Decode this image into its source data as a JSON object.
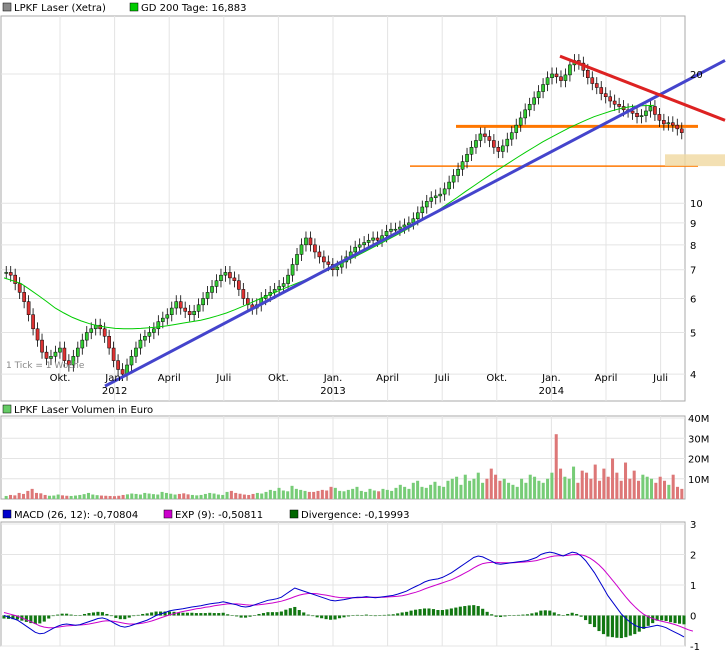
{
  "chart_data": [
    {
      "type": "candlestick",
      "legend": [
        {
          "name": "LPKF Laser (Xetra)",
          "color": "#888888"
        },
        {
          "name": "GD 200 Tage: 16,883",
          "color": "#00cc00"
        }
      ],
      "yscale": "log",
      "ylim": [
        3.5,
        27
      ],
      "y_ticks": [
        4,
        5,
        6,
        7,
        8,
        9,
        10,
        20
      ],
      "x_ticks": [
        "Okt.",
        "Jan.",
        "April",
        "Juli",
        "Okt.",
        "Jan.",
        "April",
        "Juli",
        "Okt.",
        "Jan.",
        "April",
        "Juli"
      ],
      "year_labels": [
        "2012",
        "2013",
        "2014"
      ],
      "note": "1 Tick = 1 Woche",
      "close_series": [
        6.9,
        6.8,
        6.5,
        6.2,
        5.9,
        5.5,
        5.1,
        4.8,
        4.5,
        4.35,
        4.4,
        4.5,
        4.6,
        4.3,
        4.2,
        4.4,
        4.6,
        4.8,
        5.0,
        5.1,
        5.2,
        5.1,
        4.9,
        4.6,
        4.3,
        4.1,
        4.0,
        4.2,
        4.4,
        4.6,
        4.8,
        4.9,
        5.0,
        5.1,
        5.3,
        5.4,
        5.5,
        5.7,
        5.9,
        5.7,
        5.6,
        5.5,
        5.6,
        5.8,
        6.0,
        6.2,
        6.4,
        6.6,
        6.8,
        6.9,
        6.7,
        6.6,
        6.3,
        6.0,
        5.8,
        5.7,
        5.8,
        6.0,
        6.1,
        6.2,
        6.3,
        6.4,
        6.5,
        6.8,
        7.2,
        7.6,
        8.0,
        8.3,
        8.0,
        7.7,
        7.5,
        7.3,
        7.2,
        7.0,
        7.1,
        7.3,
        7.5,
        7.7,
        7.9,
        8.0,
        8.1,
        8.2,
        8.3,
        8.2,
        8.4,
        8.6,
        8.7,
        8.7,
        8.8,
        8.9,
        9.0,
        9.2,
        9.5,
        9.8,
        10.1,
        10.3,
        10.4,
        10.5,
        10.8,
        11.2,
        11.6,
        12.0,
        12.5,
        13.0,
        13.5,
        14.0,
        14.5,
        14.3,
        14.0,
        13.5,
        13.2,
        13.6,
        14.1,
        14.6,
        15.2,
        15.8,
        16.5,
        17.0,
        17.6,
        18.2,
        18.9,
        19.6,
        20.0,
        19.7,
        19.3,
        19.9,
        21.0,
        21.5,
        21.2,
        20.4,
        19.6,
        19.0,
        18.6,
        18.0,
        17.7,
        17.3,
        17.0,
        16.8,
        16.5,
        16.4,
        16.2,
        15.9,
        16.0,
        16.4,
        16.8,
        16.1,
        15.6,
        15.3,
        15.4,
        15.2,
        14.9,
        14.6
      ],
      "ma200_series": [
        6.7,
        6.6,
        6.5,
        6.3,
        6.1,
        5.9,
        5.7,
        5.55,
        5.42,
        5.32,
        5.24,
        5.18,
        5.14,
        5.11,
        5.1,
        5.1,
        5.11,
        5.13,
        5.15,
        5.18,
        5.22,
        5.26,
        5.3,
        5.34,
        5.4,
        5.47,
        5.55,
        5.65,
        5.76,
        5.88,
        6.0,
        6.12,
        6.24,
        6.36,
        6.48,
        6.6,
        6.72,
        6.85,
        7.0,
        7.16,
        7.33,
        7.5,
        7.68,
        7.86,
        8.05,
        8.25,
        8.45,
        8.67,
        8.9,
        9.15,
        9.42,
        9.7,
        10.0,
        10.32,
        10.66,
        11.0,
        11.35,
        11.7,
        12.05,
        12.4,
        12.78,
        13.15,
        13.52,
        13.9,
        14.25,
        14.6,
        14.95,
        15.28,
        15.6,
        15.9,
        16.15,
        16.4,
        16.6,
        16.75,
        16.85,
        16.88,
        16.9
      ],
      "reference_lines": [
        {
          "name": "rising-trend",
          "color": "#4444cc",
          "from": [
            "2011-12",
            3.75
          ],
          "to": [
            "2014-08",
            21.5
          ]
        },
        {
          "name": "falling-trend",
          "color": "#dd2222",
          "from": [
            "2014-01",
            22.0
          ],
          "to": [
            "2014-08",
            15.6
          ]
        },
        {
          "name": "resistance-line",
          "color": "#ff7700",
          "value": 15.1
        },
        {
          "name": "support-line",
          "color": "#ff7700",
          "value": 12.2
        }
      ]
    },
    {
      "type": "bar",
      "legend": [
        {
          "name": "LPKF Laser Volumen in Euro",
          "color": "#66cc66"
        }
      ],
      "y_ticks": [
        "10M",
        "20M",
        "30M",
        "40M"
      ],
      "ylim": [
        0,
        40
      ],
      "values_millions": [
        1.5,
        2,
        1.8,
        3,
        2.5,
        4,
        5,
        3,
        2.8,
        2,
        1.6,
        1.7,
        2.2,
        1.8,
        1.6,
        1.5,
        1.7,
        2,
        2.4,
        3,
        2.2,
        1.9,
        1.7,
        1.6,
        1.5,
        1.4,
        1.6,
        2,
        2.3,
        2.7,
        2.5,
        2.2,
        3,
        2.7,
        2.4,
        2.2,
        3.5,
        3,
        2.6,
        2.2,
        2.5,
        2.8,
        2.3,
        2,
        1.8,
        2,
        2.5,
        3,
        2.7,
        2.2,
        2,
        3.5,
        4,
        3,
        2.6,
        2.2,
        2,
        2.5,
        3,
        2.7,
        3.5,
        4.5,
        4,
        5.5,
        4.2,
        3.8,
        6.5,
        5,
        4.5,
        4,
        3.5,
        3.5,
        4,
        4.5,
        4.2,
        6,
        5.5,
        4,
        3.8,
        4.5,
        5,
        6,
        4,
        3.5,
        5,
        4.2,
        3.8,
        5,
        4.5,
        4,
        5.5,
        7,
        6,
        5,
        8,
        9,
        6,
        5.5,
        7,
        8.5,
        6.5,
        6,
        9,
        10,
        11,
        7,
        12,
        9,
        10,
        13,
        8,
        10,
        15,
        12,
        9,
        10,
        8,
        7,
        6,
        10,
        8,
        12,
        11,
        9,
        8,
        10,
        13,
        32,
        15,
        11,
        10,
        16,
        8,
        14,
        13,
        10,
        17,
        9,
        15,
        11,
        20,
        13,
        9,
        18,
        10,
        14,
        9,
        12,
        11,
        10,
        8,
        11,
        9,
        7,
        12,
        6,
        5
      ]
    },
    {
      "type": "line",
      "legend": [
        {
          "name": "MACD (26, 12): -0,70804",
          "color": "#0000cc"
        },
        {
          "name": "EXP (9): -0,50811",
          "color": "#cc00cc"
        },
        {
          "name": "Divergence: -0,19993",
          "color": "#006600"
        }
      ],
      "y_ticks": [
        "-1",
        "0",
        "1",
        "2",
        "3"
      ],
      "ylim": [
        -1,
        3
      ],
      "macd": [
        0,
        -0.05,
        -0.1,
        -0.15,
        -0.25,
        -0.35,
        -0.45,
        -0.55,
        -0.6,
        -0.58,
        -0.5,
        -0.42,
        -0.35,
        -0.3,
        -0.28,
        -0.3,
        -0.32,
        -0.3,
        -0.25,
        -0.2,
        -0.15,
        -0.1,
        -0.08,
        -0.12,
        -0.2,
        -0.28,
        -0.35,
        -0.38,
        -0.35,
        -0.3,
        -0.25,
        -0.2,
        -0.15,
        -0.08,
        0,
        0.05,
        0.1,
        0.15,
        0.18,
        0.2,
        0.22,
        0.25,
        0.28,
        0.3,
        0.32,
        0.35,
        0.38,
        0.4,
        0.42,
        0.45,
        0.42,
        0.38,
        0.35,
        0.3,
        0.28,
        0.3,
        0.35,
        0.4,
        0.45,
        0.5,
        0.52,
        0.55,
        0.6,
        0.7,
        0.8,
        0.9,
        0.85,
        0.8,
        0.75,
        0.7,
        0.65,
        0.6,
        0.55,
        0.5,
        0.48,
        0.5,
        0.52,
        0.55,
        0.58,
        0.6,
        0.6,
        0.62,
        0.6,
        0.58,
        0.6,
        0.62,
        0.64,
        0.66,
        0.7,
        0.75,
        0.8,
        0.88,
        0.95,
        1.02,
        1.1,
        1.15,
        1.18,
        1.2,
        1.25,
        1.32,
        1.4,
        1.5,
        1.6,
        1.7,
        1.8,
        1.9,
        1.95,
        1.92,
        1.85,
        1.78,
        1.7,
        1.68,
        1.7,
        1.72,
        1.74,
        1.76,
        1.78,
        1.8,
        1.85,
        1.9,
        2.0,
        2.05,
        2.08,
        2.05,
        2.0,
        1.95,
        2.02,
        2.08,
        2.05,
        1.95,
        1.8,
        1.6,
        1.4,
        1.15,
        0.9,
        0.65,
        0.45,
        0.25,
        0.05,
        -0.1,
        -0.22,
        -0.32,
        -0.38,
        -0.4,
        -0.38,
        -0.35,
        -0.32,
        -0.35,
        -0.4,
        -0.48,
        -0.55,
        -0.62,
        -0.7
      ],
      "signal": [
        0.1,
        0.06,
        0.02,
        -0.02,
        -0.08,
        -0.14,
        -0.2,
        -0.27,
        -0.34,
        -0.38,
        -0.4,
        -0.4,
        -0.38,
        -0.36,
        -0.34,
        -0.33,
        -0.32,
        -0.31,
        -0.3,
        -0.28,
        -0.25,
        -0.22,
        -0.19,
        -0.17,
        -0.18,
        -0.2,
        -0.23,
        -0.26,
        -0.28,
        -0.28,
        -0.27,
        -0.25,
        -0.22,
        -0.18,
        -0.13,
        -0.08,
        -0.03,
        0.02,
        0.06,
        0.1,
        0.13,
        0.16,
        0.19,
        0.22,
        0.24,
        0.27,
        0.29,
        0.32,
        0.34,
        0.36,
        0.38,
        0.38,
        0.38,
        0.37,
        0.35,
        0.34,
        0.34,
        0.35,
        0.37,
        0.39,
        0.41,
        0.44,
        0.47,
        0.51,
        0.56,
        0.62,
        0.67,
        0.7,
        0.72,
        0.72,
        0.71,
        0.69,
        0.67,
        0.64,
        0.61,
        0.59,
        0.58,
        0.58,
        0.58,
        0.58,
        0.59,
        0.59,
        0.6,
        0.6,
        0.6,
        0.6,
        0.61,
        0.62,
        0.63,
        0.65,
        0.68,
        0.72,
        0.76,
        0.81,
        0.87,
        0.92,
        0.97,
        1.02,
        1.07,
        1.12,
        1.17,
        1.24,
        1.31,
        1.39,
        1.47,
        1.56,
        1.64,
        1.7,
        1.73,
        1.74,
        1.74,
        1.73,
        1.73,
        1.73,
        1.73,
        1.74,
        1.75,
        1.76,
        1.78,
        1.8,
        1.84,
        1.88,
        1.92,
        1.95,
        1.96,
        1.96,
        1.97,
        1.99,
        2.0,
        1.99,
        1.95,
        1.88,
        1.78,
        1.66,
        1.51,
        1.34,
        1.16,
        0.98,
        0.79,
        0.61,
        0.44,
        0.29,
        0.15,
        0.04,
        -0.04,
        -0.1,
        -0.15,
        -0.19,
        -0.22,
        -0.26,
        -0.3,
        -0.35,
        -0.41,
        -0.47,
        -0.51
      ]
    }
  ]
}
